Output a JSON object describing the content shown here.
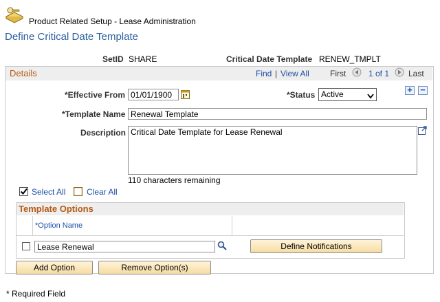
{
  "header": {
    "breadcrumb": "Product Related Setup - Lease Administration",
    "page_title": "Define Critical Date Template"
  },
  "summary": {
    "setid_label": "SetID",
    "setid_value": "SHARE",
    "template_label": "Critical Date Template",
    "template_value": "RENEW_TMPLT"
  },
  "details": {
    "title": "Details",
    "find": "Find",
    "sep": "|",
    "view_all": "View All",
    "first": "First",
    "page_of": "1 of 1",
    "last": "Last",
    "effective_from_label": "*Effective From",
    "effective_from_value": "01/01/1900",
    "status_label": "*Status",
    "status_value": "Active",
    "template_name_label": "*Template Name",
    "template_name_value": "Renewal Template",
    "description_label": "Description",
    "description_value": "Critical Date Template for Lease Renewal",
    "chars_remaining": "110 characters remaining",
    "add_row": "+",
    "delete_row": "−"
  },
  "selection": {
    "select_all": "Select All",
    "clear_all": "Clear All"
  },
  "template_options": {
    "title": "Template Options",
    "col_option_name": "*Option Name",
    "rows": [
      {
        "option_name": "Lease Renewal",
        "define_notifications": "Define Notifications"
      }
    ]
  },
  "buttons": {
    "add_option": "Add Option",
    "remove_options": "Remove Option(s)"
  },
  "footer": {
    "required_note": "* Required Field"
  },
  "colors": {
    "title_blue": "#2b5fa0",
    "section_orange": "#b65a14",
    "link_blue": "#1a4ea8"
  }
}
